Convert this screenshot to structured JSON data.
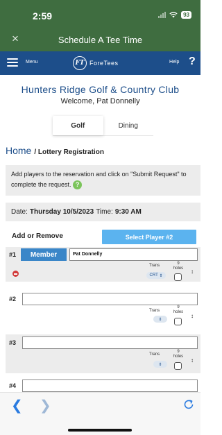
{
  "status": {
    "time": "2:59",
    "battery": "93"
  },
  "webview": {
    "close_glyph": "×",
    "title": "Schedule A Tee Time"
  },
  "nav": {
    "menu": "Menu",
    "logo_mark": "FT",
    "logo_text": "ForeTees",
    "help": "Help",
    "help_glyph": "?"
  },
  "club": {
    "name": "Hunters Ridge Golf & Country Club",
    "welcome": "Welcome, Pat Donnelly"
  },
  "tabs": [
    {
      "label": "Golf",
      "active": true
    },
    {
      "label": "Dining",
      "active": false
    }
  ],
  "breadcrumb": {
    "home": "Home",
    "separator_current": "/ Lottery Registration"
  },
  "info": {
    "text": "Add players to the reservation and click on \"Submit Request\" to complete the request.",
    "help_glyph": "?"
  },
  "date": {
    "date_label": "Date:",
    "date_value": "Thursday  10/5/2023",
    "time_label": "Time:",
    "time_value": "9:30 AM"
  },
  "players": {
    "heading": "Add or Remove",
    "select_button": "Select Player #2",
    "slots": [
      {
        "num": "#1",
        "type_button": "Member",
        "name": "Pat Donnelly",
        "trans_label": "Trans",
        "trans_value": "CRT",
        "holes_label": "9 holes",
        "holes_checked": false
      },
      {
        "num": "#2",
        "name": "",
        "trans_label": "Trans",
        "trans_value": "",
        "holes_label": "9 holes",
        "holes_checked": false
      },
      {
        "num": "#3",
        "name": "",
        "trans_label": "Trans",
        "trans_value": "",
        "holes_label": "9 holes",
        "holes_checked": false
      },
      {
        "num": "#4",
        "name": ""
      }
    ]
  },
  "colors": {
    "green_header": "#3f6d40",
    "nav_blue": "#1d4e8a",
    "accent_blue": "#5bb3ef",
    "member_blue": "#3a86c8",
    "remove_red": "#d23b3b"
  },
  "icons": {
    "close": "close-icon",
    "menu": "hamburger-icon",
    "help": "help-icon",
    "remove": "remove-player-icon",
    "sort": "sort-arrows-icon",
    "back": "back-arrow-icon",
    "forward": "forward-arrow-icon",
    "reload": "reload-icon"
  }
}
